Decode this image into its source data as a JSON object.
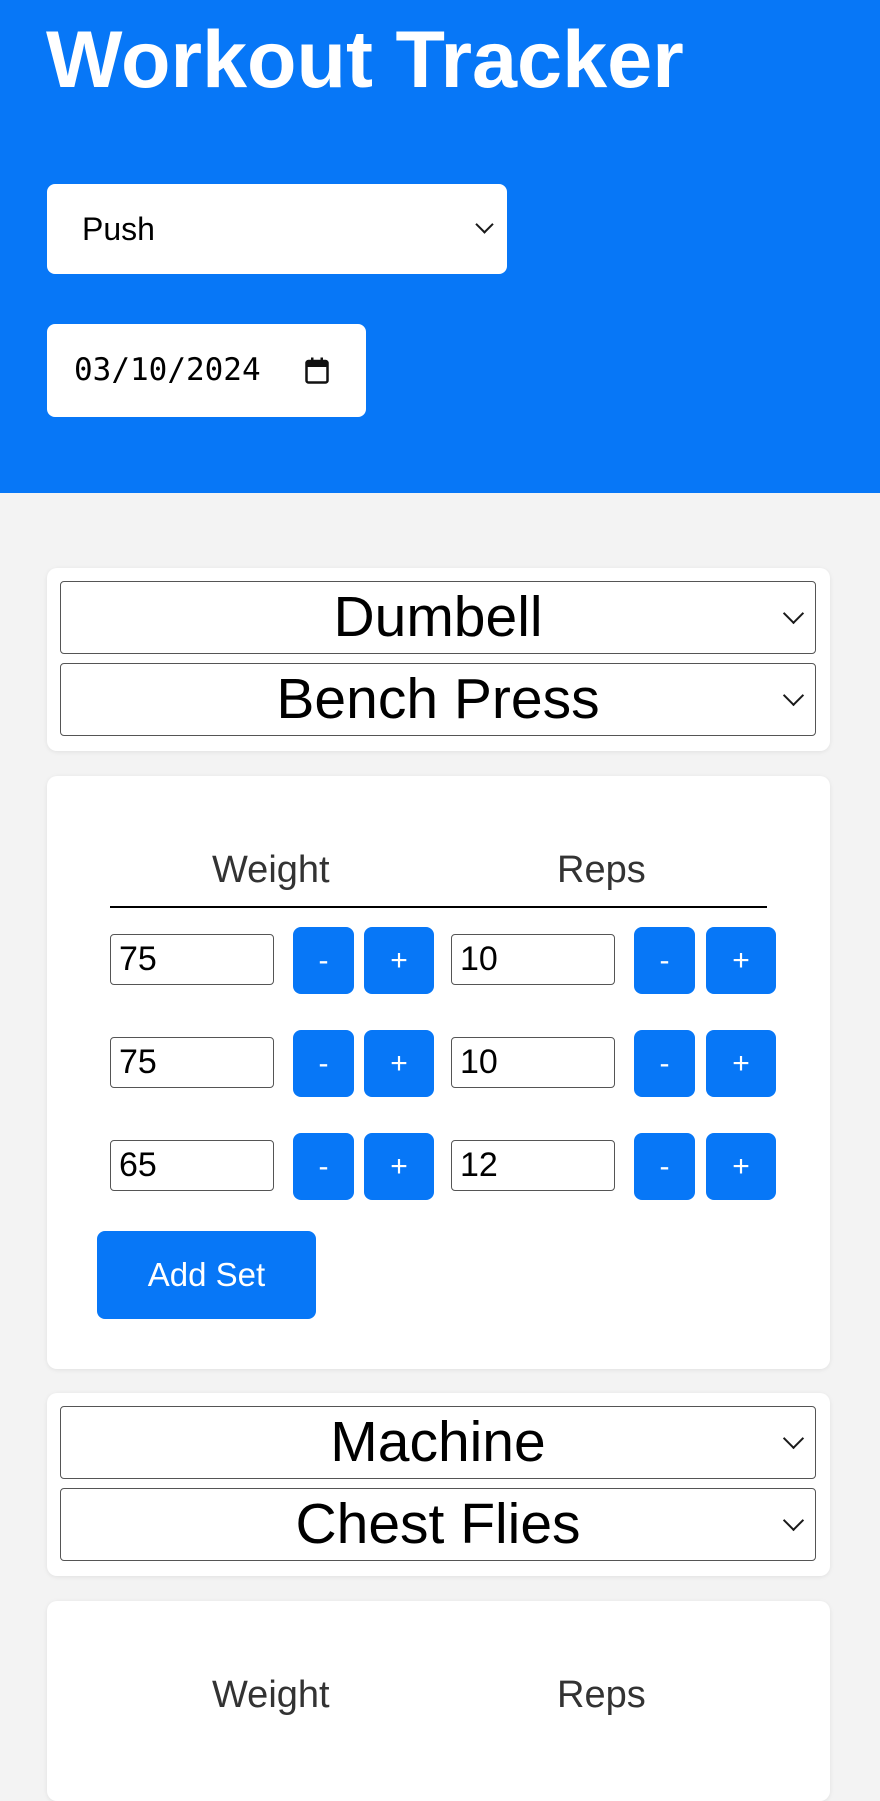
{
  "app": {
    "title": "Workout Tracker"
  },
  "header": {
    "split_value": "Push",
    "date_value": "03/10/2024"
  },
  "exercises": [
    {
      "equipment": "Dumbell",
      "name": "Bench Press",
      "weight_header": "Weight",
      "reps_header": "Reps",
      "sets": [
        {
          "weight": "75",
          "reps": "10"
        },
        {
          "weight": "75",
          "reps": "10"
        },
        {
          "weight": "65",
          "reps": "12"
        }
      ],
      "add_set_label": "Add Set"
    },
    {
      "equipment": "Machine",
      "name": "Chest Flies",
      "weight_header": "Weight",
      "reps_header": "Reps"
    }
  ],
  "buttons": {
    "decrement": "-",
    "increment": "+"
  },
  "colors": {
    "accent": "#0777f7",
    "background": "#f3f3f3",
    "card": "#ffffff"
  },
  "icons": {
    "dropdown": "chevron-down-icon",
    "calendar": "calendar-icon"
  }
}
